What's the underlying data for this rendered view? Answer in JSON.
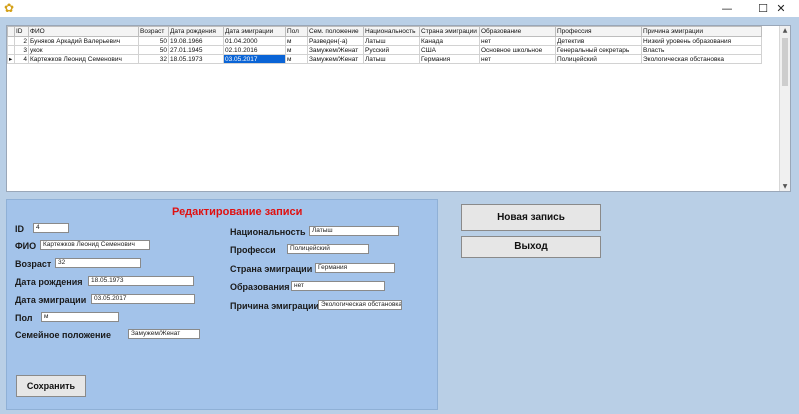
{
  "window": {
    "app_icon": "app-icon",
    "controls": {
      "minimize": "—",
      "maximize": "☐",
      "close": "✕"
    }
  },
  "grid": {
    "columns": [
      "ID",
      "ФИО",
      "Возраст",
      "Дата рождения",
      "Дата эмиграции",
      "Пол",
      "Сем. положение",
      "Национальность",
      "Страна эмиграции",
      "Образование",
      "Профессия",
      "Причина эмиграции"
    ],
    "rows": [
      {
        "marker": "",
        "cells": [
          "2",
          "Буняков Аркадий Валерьевич",
          "50",
          "19.08.1966",
          "01.04.2000",
          "м",
          "Разведен(-а)",
          "Латыш",
          "Канада",
          "нет",
          "Детектив",
          "Низкий уровень образования"
        ]
      },
      {
        "marker": "",
        "cells": [
          "3",
          "укок",
          "50",
          "27.01.1945",
          "02.10.2016",
          "м",
          "Замужем/Женат",
          "Русский",
          "США",
          "Основное школьное",
          "Генеральный секретарь",
          "Власть"
        ]
      },
      {
        "marker": "▸",
        "cells": [
          "4",
          "Картежков Леонид Семенович",
          "32",
          "18.05.1973",
          "03.05.2017",
          "м",
          "Замужем/Женат",
          "Латыш",
          "Германия",
          "нет",
          "Полицейский",
          "Экологическая обстановка"
        ]
      }
    ],
    "selected_cell": {
      "row": 2,
      "col": 4
    }
  },
  "form": {
    "title": "Редактирование записи",
    "id": {
      "label": "ID",
      "value": "4"
    },
    "fio": {
      "label": "ФИО",
      "value": "Картежков Леонид Семенович"
    },
    "age": {
      "label": "Возраст",
      "value": "32"
    },
    "birth_date": {
      "label": "Дата рождения",
      "value": "18.05.1973"
    },
    "emig_date": {
      "label": "Дата эмиграции",
      "value": "03.05.2017"
    },
    "sex": {
      "label": "Пол",
      "value": "м"
    },
    "marital": {
      "label": "Семейное положение",
      "value": "Замужем/Женат"
    },
    "nationality": {
      "label": "Национальность",
      "value": "Латыш"
    },
    "profession": {
      "label": "Професси",
      "value": "Полицейский"
    },
    "country": {
      "label": "Страна эмиграции",
      "value": "Германия"
    },
    "education": {
      "label": "Образования",
      "value": "нет"
    },
    "reason": {
      "label": "Причина эмиграции",
      "value": "Экологическая обстановка"
    },
    "save_label": "Сохранить"
  },
  "actions": {
    "new_record": "Новая запись",
    "exit": "Выход"
  },
  "colors": {
    "background": "#b9cfe6",
    "panel": "#a3c3ea",
    "title_red": "#e01010",
    "selection": "#0a64d6"
  }
}
